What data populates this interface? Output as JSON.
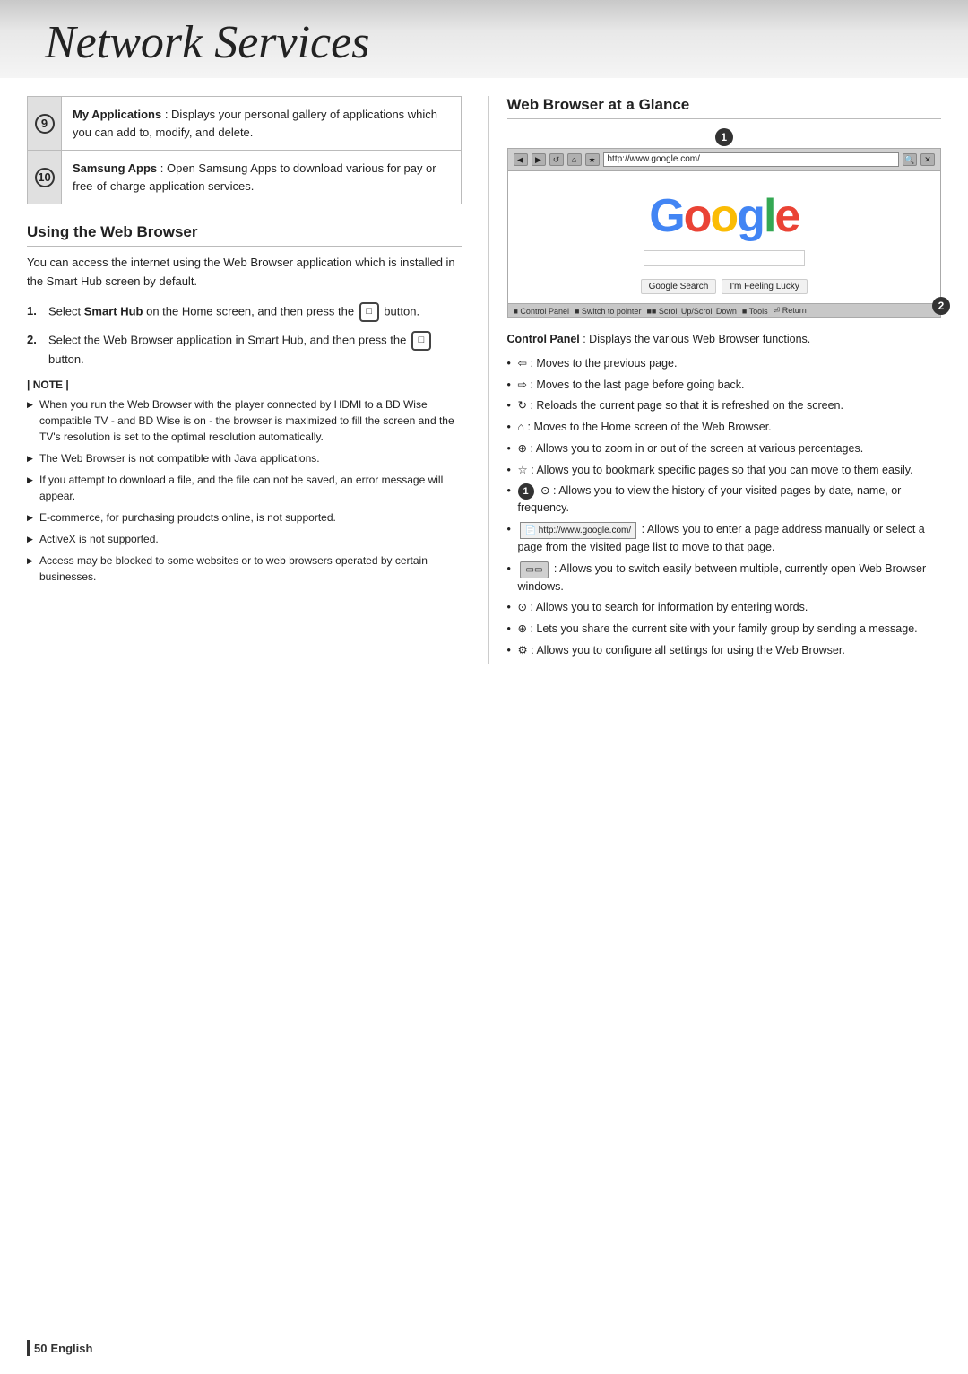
{
  "page": {
    "title": "Network Services",
    "footer_page": "50",
    "footer_language": "English"
  },
  "left_col": {
    "items": [
      {
        "num": "9",
        "title": "My Applications",
        "description": " : Displays your personal gallery of applications which you can add to, modify, and delete."
      },
      {
        "num": "10",
        "title": "Samsung Apps",
        "description": " : Open Samsung Apps to download various for pay or free-of-charge application services."
      }
    ],
    "section_heading": "Using the Web Browser",
    "section_body": "You can access the internet using the Web Browser application which is installed in the Smart Hub screen by default.",
    "steps": [
      {
        "num": "1.",
        "text": "Select Smart Hub on the Home screen, and then press the   button."
      },
      {
        "num": "2.",
        "text": "Select the Web Browser application in Smart Hub, and then press the   button."
      }
    ],
    "note_label": "| NOTE |",
    "notes": [
      "When you run the Web Browser with the player connected by HDMI to a BD Wise compatible TV - and BD Wise is on - the browser is maximized to fill the screen and the TV's resolution is set to the optimal resolution automatically.",
      "The Web Browser is not compatible with Java applications.",
      "If you attempt to download a file, and the file can not be saved, an error message will appear.",
      "E-commerce, for purchasing proudcts online, is not supported.",
      "ActiveX is not supported.",
      "Access may be blocked to some websites or to web browsers operated by certain businesses."
    ]
  },
  "right_col": {
    "heading": "Web Browser at a Glance",
    "browser": {
      "address": "http://www.google.com/",
      "google_text": "Google",
      "search_btn": "Google Search",
      "lucky_btn": "I'm Feeling Lucky",
      "status_items": [
        "Control Panel",
        "Switch to pointer",
        "Scroll Up/Scroll Down",
        "Tools",
        "Return"
      ]
    },
    "marker1": "1",
    "marker2": "2",
    "control_panel_title": "Control Panel",
    "control_panel_desc": " : Displays the various Web Browser functions.",
    "bullets": [
      " : Moves to the previous page.",
      " : Moves to the last page before going back.",
      " : Reloads the current page so that it is refreshed on the screen.",
      " : Moves to the Home screen of the Web Browser.",
      " : Allows you to zoom in or out of the screen at various percentages.",
      " : Allows you to bookmark specific pages so that you can move to them easily.",
      " : Allows you to view the history of your visited pages by date, name, or frequency.",
      " : Allows you to enter a page address manually or select a page from the visited page list to move to that page.",
      " : Allows you to switch easily between multiple, currently open Web Browser windows.",
      " : Allows you to search for information by entering words.",
      " : Lets you share the current site with your family group by sending a message.",
      " : Allows you to configure all settings for using the Web Browser."
    ],
    "bullet_icons": [
      "⇦",
      "⇨",
      "↻",
      "⌂",
      "🔍",
      "☆",
      "①",
      "url",
      "⊟",
      "🔎",
      "📤",
      "⚙"
    ]
  }
}
